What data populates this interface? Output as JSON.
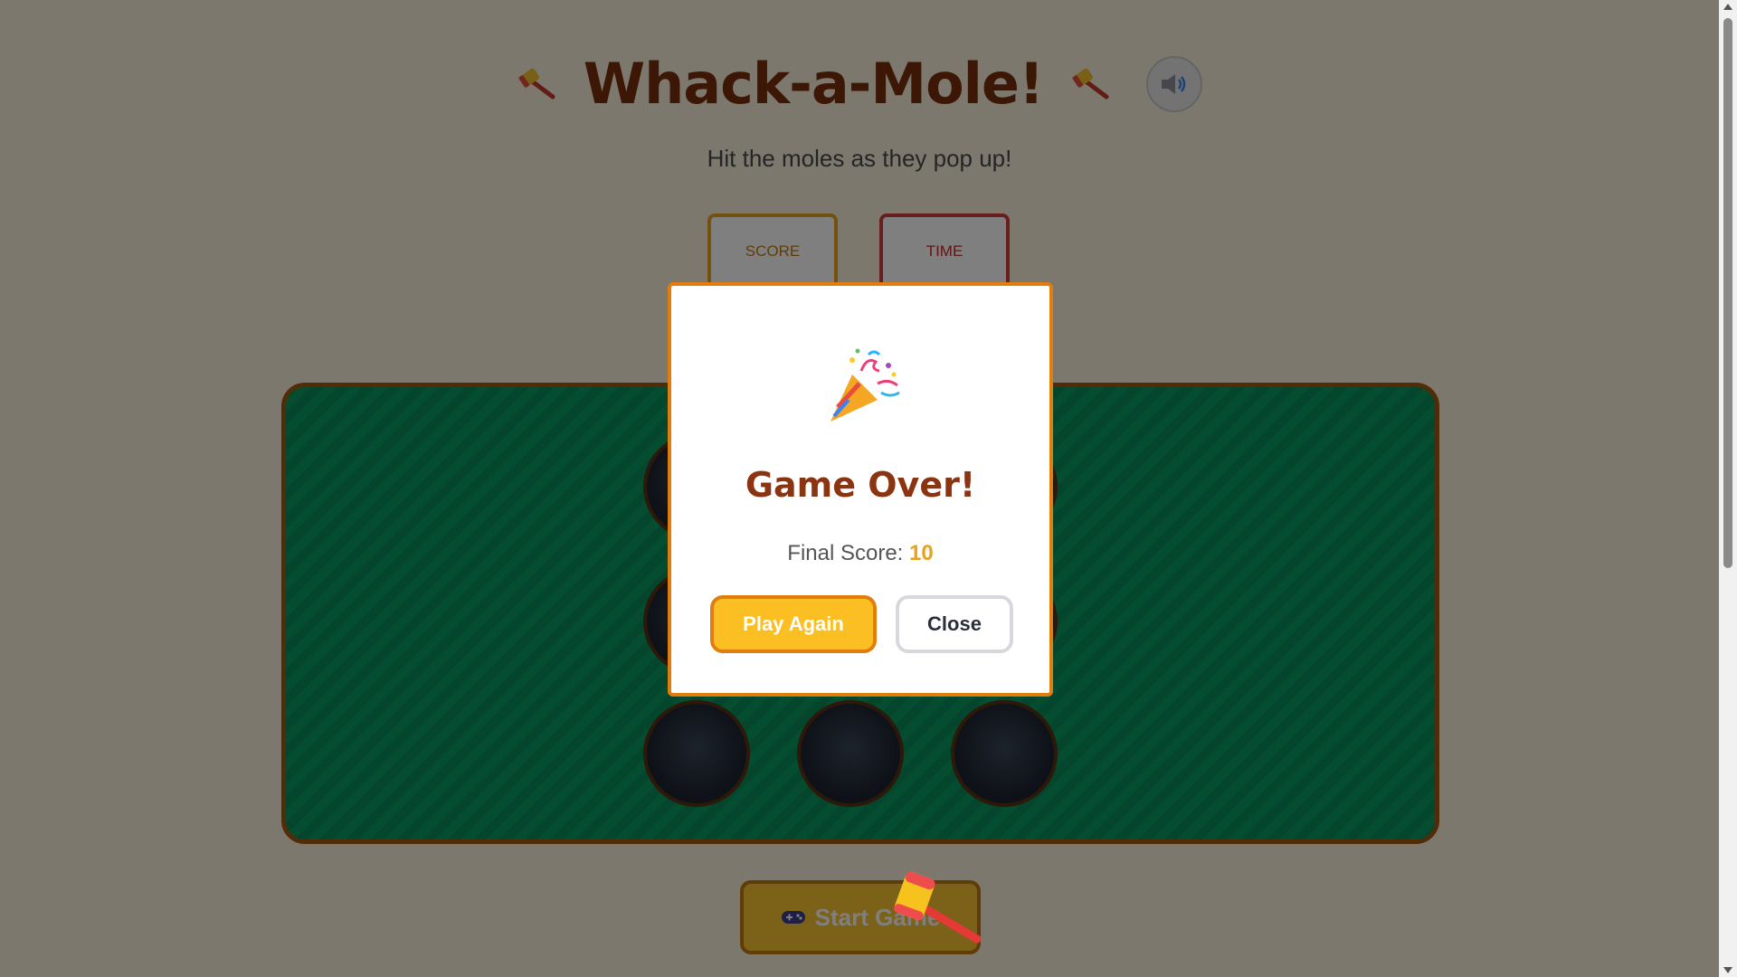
{
  "header": {
    "title": "Whack-a-Mole!",
    "subtitle": "Hit the moles as they pop up!",
    "left_icon": "hammer-icon",
    "right_icon": "hammer-icon",
    "sound_icon": "speaker-icon"
  },
  "stats": {
    "score_label": "SCORE",
    "time_label": "TIME"
  },
  "board": {
    "holes_visible": 9,
    "colors": {
      "grass": "#0a9a63",
      "frame": "#a15a10",
      "hole": "#1f2733"
    }
  },
  "controls": {
    "start_label": "Start Game",
    "start_icon": "gamepad-icon"
  },
  "modal": {
    "icon": "party-popper-icon",
    "title": "Game Over!",
    "final_score_label": "Final Score:",
    "final_score_value": "10",
    "play_again_label": "Play Again",
    "close_label": "Close"
  },
  "colors": {
    "accent": "#fbbf24",
    "accent_border": "#e07d0c",
    "title": "#7a2e0c"
  }
}
